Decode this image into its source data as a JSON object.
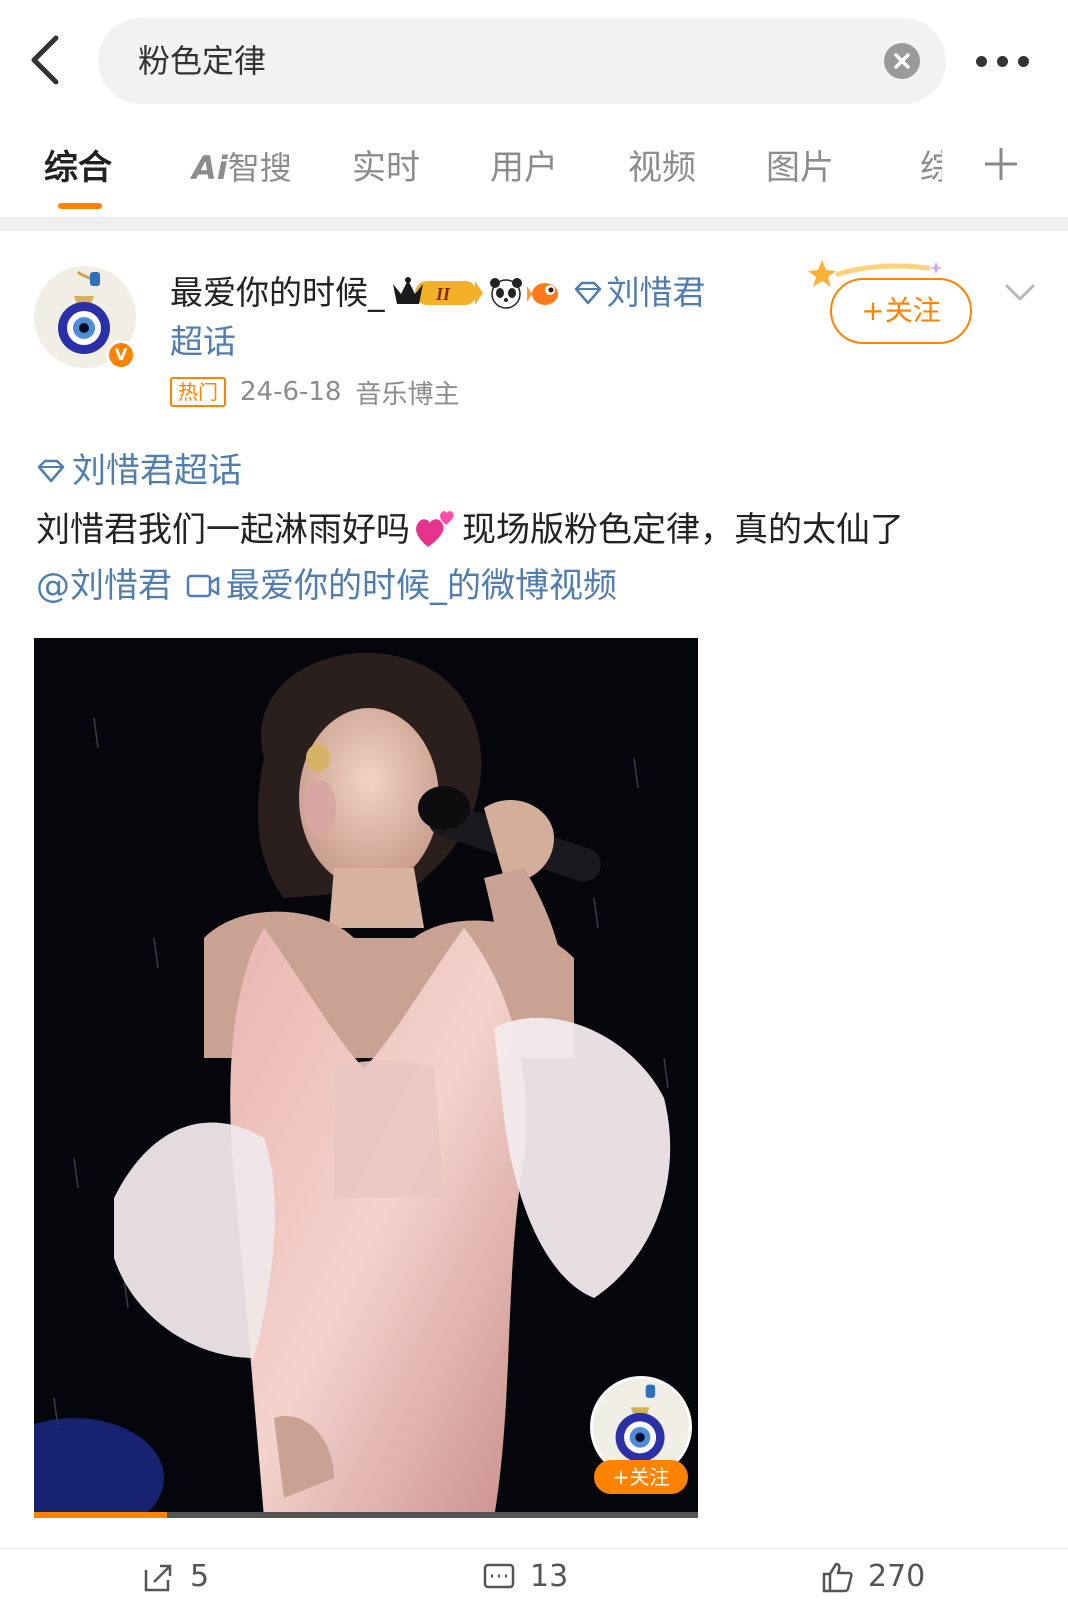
{
  "search": {
    "query": "粉色定律"
  },
  "tabs": [
    {
      "label": "综合",
      "active": true
    },
    {
      "label": "智搜",
      "prefix": "Ai"
    },
    {
      "label": "实时"
    },
    {
      "label": "用户"
    },
    {
      "label": "视频"
    },
    {
      "label": "图片"
    },
    {
      "label": "综"
    }
  ],
  "post": {
    "username": "最爱你的时候_",
    "level_badge": "II",
    "supertopic_part1": "刘惜君",
    "supertopic_part2": "超话",
    "hot_tag": "热门",
    "date": "24-6-18",
    "user_title": "音乐博主",
    "follow_label": "+关注",
    "topic": "刘惜君超话",
    "text_part1": "刘惜君我们一起淋雨好吗",
    "text_part2": "现场版粉色定律，真的太仙了",
    "mention": "@刘惜君",
    "video_link": "最爱你的时候_的微博视频",
    "video_follow_label": "+关注",
    "video_progress": 0.2
  },
  "actions": {
    "repost_count": "5",
    "comment_count": "13",
    "like_count": "270"
  },
  "colors": {
    "accent": "#ff8200",
    "link": "#507daf"
  },
  "icons": {
    "back": "chevron-left-icon",
    "clear": "clear-circle-icon",
    "more": "more-dots-icon",
    "add_tab": "plus-icon",
    "supertopic": "diamond-icon",
    "video": "video-icon",
    "repost": "repost-icon",
    "comment": "comment-icon",
    "like": "like-icon"
  }
}
